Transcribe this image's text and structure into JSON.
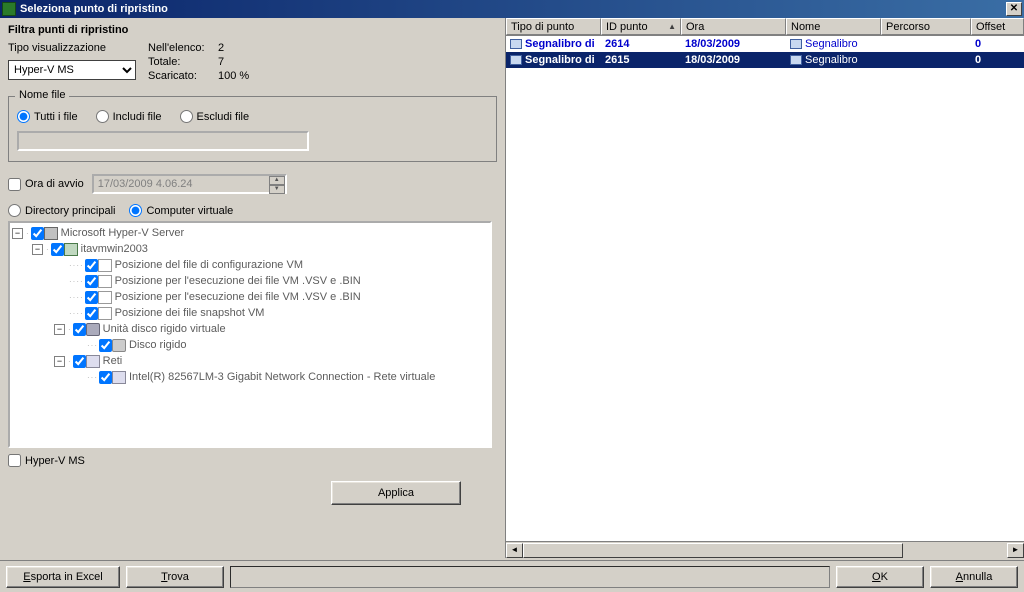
{
  "window": {
    "title": "Seleziona punto di ripristino"
  },
  "filter": {
    "section_title": "Filtra punti di ripristino",
    "display_type_label": "Tipo visualizzazione",
    "display_type_value": "Hyper-V MS",
    "stats": {
      "in_list_label": "Nell'elenco:",
      "in_list_value": "2",
      "total_label": "Totale:",
      "total_value": "7",
      "downloaded_label": "Scaricato:",
      "downloaded_value": "100 %"
    }
  },
  "filename_group": {
    "legend": "Nome file",
    "opt_all": "Tutti i file",
    "opt_include": "Includi file",
    "opt_exclude": "Escludi file"
  },
  "start_time": {
    "label": "Ora di avvio",
    "value": "17/03/2009   4.06.24"
  },
  "dir_mode": {
    "main_dirs": "Directory principali",
    "virtual_computer": "Computer virtuale"
  },
  "tree": {
    "root": "Microsoft Hyper-V Server",
    "vm": "itavmwin2003",
    "n1": "Posizione del file di configurazione VM",
    "n2": "Posizione per l'esecuzione dei file VM .VSV e .BIN",
    "n3": "Posizione per l'esecuzione dei file VM .VSV e .BIN",
    "n4": "Posizione dei file snapshot VM",
    "n5": "Unità disco rigido virtuale",
    "n5a": "Disco rigido",
    "n6": "Reti",
    "n6a": "Intel(R) 82567LM-3 Gigabit Network Connection - Rete virtuale"
  },
  "hyperv_checkbox": "Hyper-V MS",
  "buttons": {
    "apply": "Applica",
    "export_excel": "Esporta in Excel",
    "find": "Trova",
    "ok": "OK",
    "cancel": "Annulla"
  },
  "table": {
    "columns": {
      "type": "Tipo di punto",
      "id": "ID punto",
      "time": "Ora",
      "name": "Nome",
      "path": "Percorso",
      "offset": "Offset"
    },
    "col_widths": {
      "type": 95,
      "id": 80,
      "time": 105,
      "name": 95,
      "path": 90,
      "offset": 47
    },
    "rows": [
      {
        "type": "Segnalibro di",
        "id": "2614",
        "time": "18/03/2009",
        "name": "Segnalibro",
        "path": "",
        "offset": "0"
      },
      {
        "type": "Segnalibro di",
        "id": "2615",
        "time": "18/03/2009",
        "name": "Segnalibro",
        "path": "",
        "offset": "0"
      }
    ]
  }
}
